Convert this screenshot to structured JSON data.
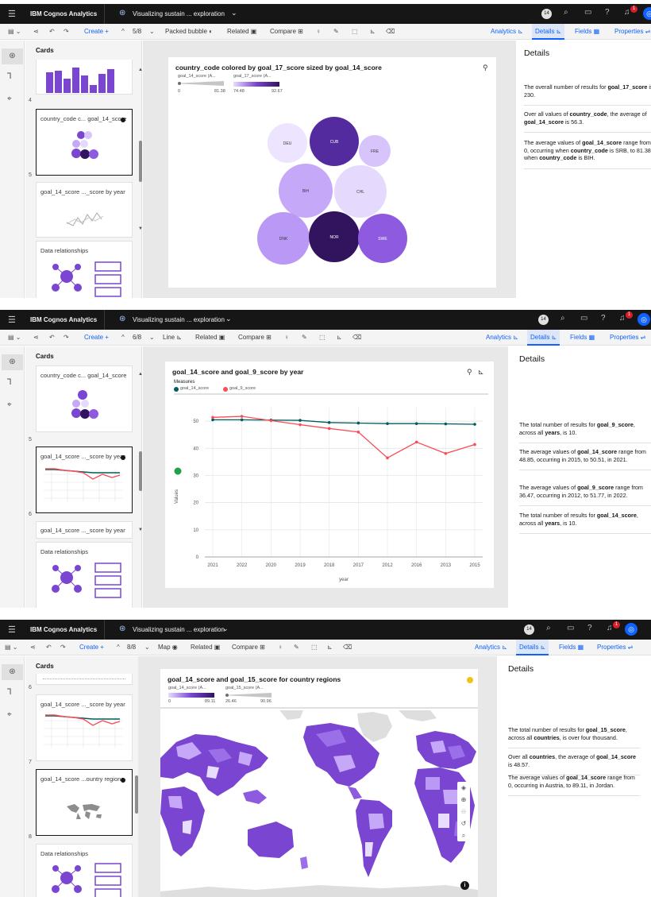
{
  "app": {
    "title": "IBM Cognos Analytics",
    "exploration": "Visualizing sustain ... exploration",
    "notif_count": "1",
    "user_pill": "14"
  },
  "toolbar": {
    "create": "Create",
    "related": "Related",
    "compare": "Compare",
    "tabs": {
      "analytics": "Analytics",
      "details": "Details",
      "fields": "Fields",
      "properties": "Properties"
    }
  },
  "cards_header": "Cards",
  "shot1": {
    "counter": "5/8",
    "viz_type": "Packed bubble",
    "cards": [
      {
        "num": "4",
        "title": ""
      },
      {
        "num": "5",
        "title": "country_code c... goal_14_score"
      },
      {
        "num": "",
        "title": "goal_14_score ..._score by year"
      },
      {
        "num": "",
        "title": "Data relationships"
      }
    ],
    "viz_title": "country_code colored by goal_17_score sized by goal_14_score",
    "legend": {
      "size_label": "goal_14_score (A...",
      "size_min": "0",
      "size_max": "81.38",
      "color_label": "goal_17_score (A...",
      "color_min": "74.48",
      "color_max": "92.67"
    },
    "chart_data": {
      "type": "packed bubble",
      "title": "country_code colored by goal_17_score sized by goal_14_score",
      "points": [
        {
          "label": "DEU",
          "color": "#ede4ff"
        },
        {
          "label": "CUB",
          "color": "#542b9e"
        },
        {
          "label": "FRE",
          "color": "#d6c4fb"
        },
        {
          "label": "BIH",
          "color": "#c5a8f8"
        },
        {
          "label": "CHL",
          "color": "#e5dafd"
        },
        {
          "label": "DNK",
          "color": "#b999f5"
        },
        {
          "label": "NOR",
          "color": "#31135e"
        },
        {
          "label": "SWE",
          "color": "#8e5be0"
        }
      ],
      "size_range": [
        0,
        81.38
      ],
      "color_range": [
        74.48,
        92.67
      ]
    },
    "details": {
      "heading": "Details",
      "paras": [
        [
          "The overall number of results for ",
          "goal_17_score",
          " is 230."
        ],
        [
          "Over all values of ",
          "country_code",
          ", the average of ",
          "goal_14_score",
          " is 56.3."
        ],
        [
          "The average values of ",
          "goal_14_score",
          " range from 0, occurring when ",
          "country_code",
          " is SRB, to 81.38, when ",
          "country_code",
          " is BIH."
        ]
      ]
    }
  },
  "shot2": {
    "counter": "6/8",
    "viz_type": "Line",
    "cards": [
      {
        "num": "5",
        "title": "country_code c... goal_14_score"
      },
      {
        "num": "6",
        "title": "goal_14_score ..._score by year"
      },
      {
        "num": "",
        "title": "goal_14_score ..._score by year"
      },
      {
        "num": "",
        "title": "Data relationships"
      }
    ],
    "viz_title": "goal_14_score and goal_9_score by year",
    "legend_title": "Measures",
    "chart_data": {
      "type": "line",
      "title": "goal_14_score and goal_9_score by year",
      "xlabel": "year",
      "ylabel": "Values",
      "categories": [
        "2021",
        "2022",
        "2020",
        "2019",
        "2018",
        "2017",
        "2012",
        "2016",
        "2013",
        "2015"
      ],
      "series": [
        {
          "name": "goal_14_score",
          "color": "#005d5d",
          "values": [
            50.51,
            50.5,
            50.4,
            50.3,
            49.5,
            49.3,
            49.1,
            49.1,
            49.0,
            48.85
          ]
        },
        {
          "name": "goal_9_score",
          "color": "#fa4d56",
          "values": [
            51.4,
            51.77,
            50.2,
            48.7,
            47.3,
            46.0,
            36.47,
            42.3,
            38.1,
            41.4
          ]
        }
      ],
      "ylim": [
        0,
        55
      ],
      "yticks": [
        0,
        10,
        20,
        30,
        40,
        50
      ]
    },
    "details": {
      "heading": "Details",
      "paras": [
        [
          "The total number of results for ",
          "goal_9_score",
          ", across all ",
          "years",
          ", is 10."
        ],
        [
          "The average values of ",
          "goal_14_score",
          " range from 48.85, occurring in 2015, to 50.51, in 2021."
        ],
        [
          "The average values of ",
          "goal_9_score",
          " range from 36.47, occurring in 2012, to 51.77, in 2022."
        ],
        [
          "The total number of results for ",
          "goal_14_score",
          ", across all ",
          "years",
          ", is 10."
        ]
      ]
    }
  },
  "shot3": {
    "counter": "8/8",
    "viz_type": "Map",
    "cards": [
      {
        "num": "6",
        "title": ""
      },
      {
        "num": "7",
        "title": "goal_14_score ..._score by year"
      },
      {
        "num": "8",
        "title": "goal_14_score ...ountry regions"
      },
      {
        "num": "",
        "title": "Data relationships"
      }
    ],
    "viz_title": "goal_14_score and goal_15_score for country regions",
    "legend": {
      "color_label": "goal_14_score (A...",
      "color_min": "0",
      "color_max": "89.11",
      "size_label": "goal_15_score (A...",
      "size_min": "26.46",
      "size_max": "90.96"
    },
    "details": {
      "heading": "Details",
      "paras": [
        [
          "The total number of results for ",
          "goal_15_score",
          ", across all ",
          "countries",
          ", is over four thousand."
        ],
        [
          "Over all ",
          "countries",
          ", the average of ",
          "goal_14_score",
          " is 48.57."
        ],
        [
          "The average values of ",
          "goal_14_score",
          " range from 0, occurring in Austria, to 89.11, in Jordan."
        ]
      ]
    }
  }
}
